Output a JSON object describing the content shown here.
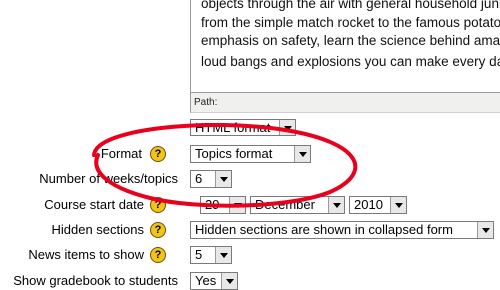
{
  "editor": {
    "lines": [
      "objects through the air with general household junk",
      "from the simple match rocket to the famous potato",
      "emphasis on safety, learn the science behind amazing",
      "loud bangs and explosions you can make every day"
    ],
    "path_label": "Path:",
    "html_format": "HTML format"
  },
  "fields": {
    "format": {
      "label": "Format",
      "value": "Topics format"
    },
    "numsections": {
      "label": "Number of weeks/topics",
      "value": "6"
    },
    "startdate": {
      "label": "Course start date",
      "day": "29",
      "month": "December",
      "year": "2010"
    },
    "hiddensections": {
      "label": "Hidden sections",
      "value": "Hidden sections are shown in collapsed form"
    },
    "newsitems": {
      "label": "News items to show",
      "value": "5"
    },
    "gradebook": {
      "label": "Show gradebook to students",
      "value": "Yes"
    }
  },
  "help_glyph": "?",
  "colors": {
    "annotation": "#e8001c",
    "help_icon": "#f2c318"
  }
}
